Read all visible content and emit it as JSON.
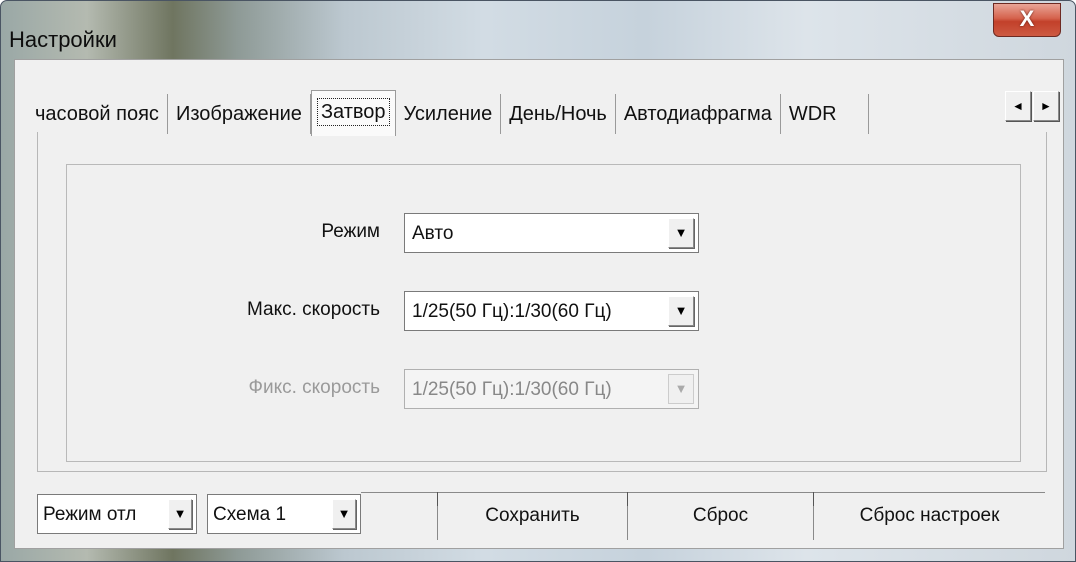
{
  "window": {
    "title": "Настройки",
    "close_label": "X"
  },
  "tabs": [
    {
      "label": "часовой пояс"
    },
    {
      "label": "Изображение"
    },
    {
      "label": "Затвор"
    },
    {
      "label": "Усиление"
    },
    {
      "label": "День/Ночь"
    },
    {
      "label": "Автодиафрагма"
    },
    {
      "label": "WDR"
    }
  ],
  "active_tab": "Затвор",
  "tab_scroll": {
    "left": "◄",
    "right": "►"
  },
  "shutter": {
    "mode": {
      "label": "Режим",
      "value": "Авто"
    },
    "max_speed": {
      "label": "Макс. скорость",
      "value": "1/25(50 Гц):1/30(60 Гц)"
    },
    "fixed_speed": {
      "label": "Фикс. скорость",
      "value": "1/25(50 Гц):1/30(60 Гц)",
      "disabled": true
    }
  },
  "bottom": {
    "debug_mode": "Режим отл",
    "scheme": "Схема 1",
    "save_label": "Сохранить",
    "reset_label": "Сброс",
    "factory_reset_label": "Сброс настроек"
  },
  "combo_arrow": "▼"
}
